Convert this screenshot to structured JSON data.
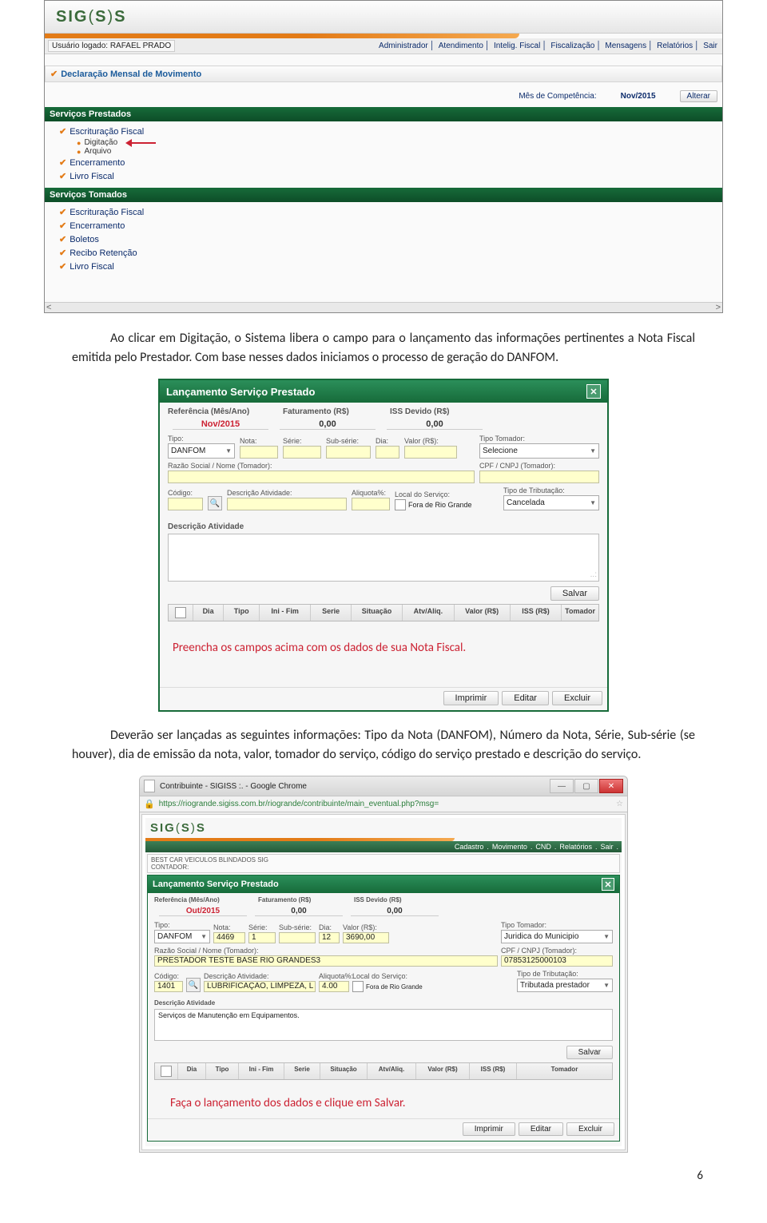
{
  "screenshot1": {
    "logo": "SIG(S)S",
    "user_label": "Usuário logado: RAFAEL PRADO",
    "navlinks": [
      "Administrador",
      "Atendimento",
      "Intelig. Fiscal",
      "Fiscalização",
      "Mensagens",
      "Relatórios",
      "Sair"
    ],
    "section_title": "Declaração Mensal de Movimento",
    "comp_label": "Mês de Competência:",
    "comp_value": "Nov/2015",
    "alterar_btn": "Alterar",
    "band_prestados": "Serviços Prestados",
    "band_tomados": "Serviços Tomados",
    "menu_prestados": {
      "escrituracao": "Escrituração Fiscal",
      "digitacao": "Digitação",
      "arquivo": "Arquivo",
      "encerramento": "Encerramento",
      "livro": "Livro Fiscal"
    },
    "menu_tomados": {
      "escrituracao": "Escrituração Fiscal",
      "encerramento": "Encerramento",
      "boletos": "Boletos",
      "recibo": "Recibo Retenção",
      "livro": "Livro Fiscal"
    }
  },
  "para1": "Ao clicar em Digitação, o Sistema libera o campo para o lançamento das informações pertinentes a Nota Fiscal emitida pelo Prestador. Com base nesses dados iniciamos o processo de geração do DANFOM.",
  "modal1": {
    "title": "Lançamento Serviço Prestado",
    "ref_label": "Referência (Mês/Ano)",
    "fat_label": "Faturamento (R$)",
    "iss_label": "ISS Devido (R$)",
    "ref_value": "Nov/2015",
    "fat_value": "0,00",
    "iss_value": "0,00",
    "tipo_label": "Tipo:",
    "tipo_value": "DANFOM",
    "nota_label": "Nota:",
    "serie_label": "Série:",
    "subserie_label": "Sub-série:",
    "dia_label": "Dia:",
    "valor_label": "Valor (R$):",
    "tipotom_label": "Tipo Tomador:",
    "tipotom_value": "Selecione",
    "razao_label": "Razão Social / Nome (Tomador):",
    "cpfcnpj_label": "CPF / CNPJ (Tomador):",
    "cod_label": "Código:",
    "descativ_label": "Descrição Atividade:",
    "aliq_label": "Aliquota%:",
    "local_label": "Local do Serviço:",
    "fora_label": "Fora de Rio Grande",
    "tipotrib_label": "Tipo de Tributação:",
    "tipotrib_value": "Cancelada",
    "descativ2_label": "Descrição Atividade",
    "salvar_btn": "Salvar",
    "th_chk": "",
    "th_dia": "Dia",
    "th_tipo": "Tipo",
    "th_ini": "Ini - Fim",
    "th_serie": "Serie",
    "th_sit": "Situação",
    "th_atv": "Atv/Aliq.",
    "th_valor": "Valor (R$)",
    "th_iss": "ISS (R$)",
    "th_tom": "Tomador",
    "red_note": "Preencha os campos acima com os dados de sua Nota Fiscal.",
    "imprimir_btn": "Imprimir",
    "editar_btn": "Editar",
    "excluir_btn": "Excluir"
  },
  "para2": "Deverão ser lançadas as seguintes informações: Tipo da Nota (DANFOM), Número da Nota, Série, Sub-série (se houver), dia de emissão da nota, valor, tomador do serviço, código do serviço prestado e descrição do serviço.",
  "sshot3": {
    "tab_title": "Contribuinte - SIGISS :. - Google Chrome",
    "url": "https://riogrande.sigiss.com.br/riogrande/contribuinte/main_eventual.php?msg=",
    "logo": "SIG(S)S",
    "navlinks": [
      "Cadastro",
      "Movimento",
      "CND",
      "Relatórios",
      "Sair"
    ],
    "user1": "BEST CAR VEICULOS BLINDADOS SIG",
    "user2": "CONTADOR:",
    "modal": {
      "title": "Lançamento Serviço Prestado",
      "ref_label": "Referência (Mês/Ano)",
      "fat_label": "Faturamento (R$)",
      "iss_label": "ISS Devido (R$)",
      "ref_value": "Out/2015",
      "fat_value": "0,00",
      "iss_value": "0,00",
      "tipo_label": "Tipo:",
      "tipo_value": "DANFOM",
      "nota_label": "Nota:",
      "nota_value": "4469",
      "serie_label": "Série:",
      "serie_value": "1",
      "subserie_label": "Sub-série:",
      "dia_label": "Dia:",
      "dia_value": "12",
      "valor_label": "Valor (R$):",
      "valor_value": "3690,00",
      "tipotom_label": "Tipo Tomador:",
      "tipotom_value": "Juridica do Municipio",
      "razao_label": "Razão Social / Nome (Tomador):",
      "razao_value": "PRESTADOR TESTE BASE RIO GRANDES3",
      "cpfcnpj_label": "CPF / CNPJ (Tomador):",
      "cpfcnpj_value": "07853125000103",
      "cod_label": "Código:",
      "cod_value": "1401",
      "descativ_label": "Descrição Atividade:",
      "descativ_value": "LUBRIFICAÇÃO, LIMPEZA, L",
      "aliq_label": "Aliquota%:",
      "aliq_value": "4.00",
      "local_label": "Local do Serviço:",
      "fora_label": "Fora de Rio Grande",
      "tipotrib_label": "Tipo de Tributação:",
      "tipotrib_value": "Tributada prestador",
      "descativ2_label": "Descrição Atividade",
      "descativ2_value": "Serviços de Manutenção em Equipamentos.",
      "salvar_btn": "Salvar",
      "th_dia": "Dia",
      "th_tipo": "Tipo",
      "th_ini": "Ini - Fim",
      "th_serie": "Serie",
      "th_sit": "Situação",
      "th_atv": "Atv/Aliq.",
      "th_valor": "Valor (R$)",
      "th_iss": "ISS (R$)",
      "th_tom": "Tomador",
      "red_note": "Faça o lançamento dos dados e clique em Salvar.",
      "imprimir_btn": "Imprimir",
      "editar_btn": "Editar",
      "excluir_btn": "Excluir"
    }
  },
  "page_no": "6"
}
